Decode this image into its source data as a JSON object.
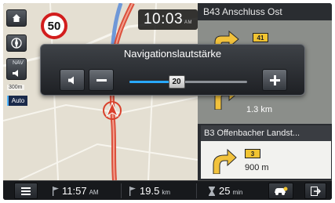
{
  "map": {
    "speed_limit": "50",
    "clock_time": "10:03",
    "clock_suffix": "AM",
    "nav_label": "NAV",
    "scale": "300m",
    "auto_label": "Auto"
  },
  "guidance": {
    "street_1": "B43 Anschluss Ost",
    "exit_1": "41",
    "distance_1": "1.3 km",
    "street_2": "B3 Offenbacher Landst...",
    "exit_2": "3",
    "distance_2": "900 m"
  },
  "volume_popup": {
    "title": "Navigationslautstärke",
    "value": "20",
    "level_percent": 40
  },
  "bottom_bar": {
    "arrival_time": "11:57",
    "arrival_suffix": "AM",
    "distance": "19.5",
    "distance_unit": "km",
    "duration": "25",
    "duration_unit": "min"
  },
  "colors": {
    "accent_blue": "#29a8ff",
    "route_red": "#d9402b",
    "exit_yellow": "#f1c431"
  }
}
